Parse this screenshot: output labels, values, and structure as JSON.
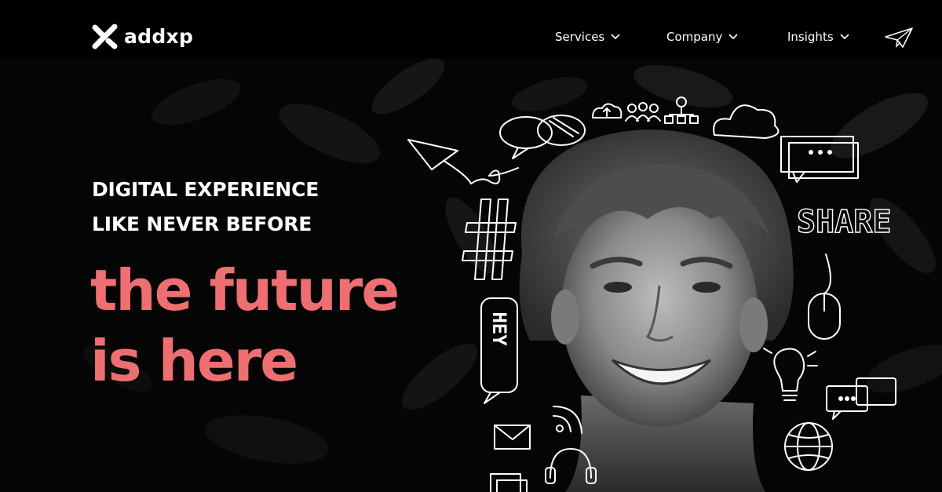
{
  "brand": {
    "name": "addxp"
  },
  "nav": {
    "items": [
      {
        "label": "Services"
      },
      {
        "label": "Company"
      },
      {
        "label": "Insights"
      }
    ],
    "contact_icon": "paper-plane-icon"
  },
  "hero": {
    "subtitle_line1": "DIGITAL EXPERIENCE",
    "subtitle_line2": "LIKE NEVER BEFORE",
    "headline_line1": "the future",
    "headline_line2": "is here",
    "accent_color": "#ee6f71"
  },
  "doodles": {
    "hey_text": "HEY",
    "share_text": "SHARE",
    "hash_text": "#",
    "icons": [
      "paper-plane-icon",
      "chat-bubble-icon",
      "cloud-upload-icon",
      "people-icon",
      "org-chart-icon",
      "cloud-icon",
      "message-icon",
      "mouse-icon",
      "lightbulb-icon",
      "chat-bubbles-icon",
      "globe-icon",
      "wifi-icon",
      "mail-icon",
      "headphones-icon"
    ]
  }
}
